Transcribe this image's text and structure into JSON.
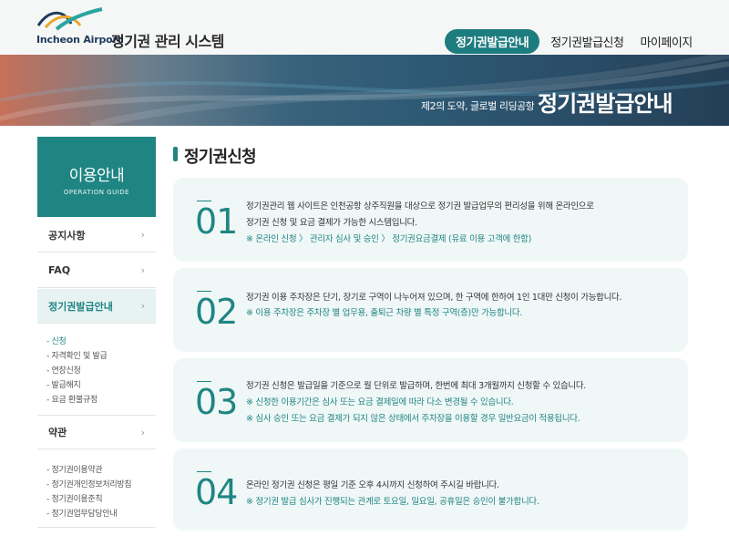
{
  "header": {
    "logo_text": "Incheon Airport",
    "site_title": "정기권 관리 시스템",
    "nav": [
      {
        "label": "정기권발급안내",
        "active": true
      },
      {
        "label": "정기권발급신청",
        "active": false
      },
      {
        "label": "마이페이지",
        "active": false
      }
    ]
  },
  "banner": {
    "subtitle": "제2의 도약, 글로벌 리딩공항",
    "title": "정기권발급안내"
  },
  "sidebar": {
    "head_title": "이용안내",
    "head_sub": "OPERATION GUIDE",
    "items": [
      {
        "label": "공지사항"
      },
      {
        "label": "FAQ"
      },
      {
        "label": "정기권발급안내"
      },
      {
        "label": "약관"
      }
    ],
    "guide_sub": [
      "- 신청",
      "- 자격확인 및 발급",
      "- 연장신청",
      "- 발급해지",
      "- 요금 환불규정"
    ],
    "terms_sub": [
      "- 정기권이용약관",
      "- 정기권개인정보처리방침",
      "- 정기권이용준칙",
      "- 정기권업무담당안내"
    ]
  },
  "content": {
    "title": "정기권신청",
    "cards": [
      {
        "num": "01",
        "lines": [
          {
            "text": "정기권관리 웹 사이트은 인천공항 상주직원을 대상으로 정기권 발급업무의 편리성을 위해 온라인으로",
            "note": false
          },
          {
            "text": "정기권 신청 및 요금 결제가 가능한 시스템입니다.",
            "note": false
          },
          {
            "text": "※ 온라인 신청 〉 관리자 심사 및 승인 〉 정기권요금결제 (유료 이용 고객에 한함)",
            "note": true
          }
        ]
      },
      {
        "num": "02",
        "lines": [
          {
            "text": "정기권 이용 주차장은 단기, 장기로 구역이 나누어져 있으며, 한 구역에 한하여 1인 1대만 신청이 가능합니다.",
            "note": false
          },
          {
            "text": "※ 이용 주차장은 주차장 별 업무용, 출퇴근 차량 별 특정 구역(층)만 가능합니다.",
            "note": true
          }
        ]
      },
      {
        "num": "03",
        "lines": [
          {
            "text": "정기권 신청은 발급일을 기준으로 월 단위로 발급하며, 한번에 최대 3개월까지 신청할 수 있습니다.",
            "note": false
          },
          {
            "text": "※ 신청한 이용기간은 심사 또는 요금 결제일에 따라 다소 변경될 수 있습니다.",
            "note": true
          },
          {
            "text": "※ 심사 승인 또는 요금 결제가 되지 않은 상태에서 주차장을 이용할 경우 일반요금이 적용됩니다.",
            "note": true
          }
        ]
      },
      {
        "num": "04",
        "lines": [
          {
            "text": "온라인 정기권 신청은 평일 기준 오후 4시까지 신청하여 주시길 바랍니다.",
            "note": false
          },
          {
            "text": "※ 정기권 발급 심사가 진행되는 관계로 토요일, 일요일, 공휴일은 승인이 불가합니다.",
            "note": true
          }
        ]
      }
    ]
  },
  "colors": {
    "accent": "#1f8583"
  }
}
